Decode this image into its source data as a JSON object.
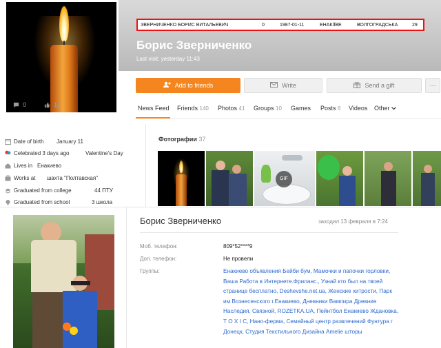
{
  "header": {
    "record": {
      "full_name": "ЗВЕРНИЧЕНКО БОРИС ВИТАЛЬЕВИЧ",
      "num": "0",
      "date": "1987-01-11",
      "city": "ЕНАКІЇВЕ",
      "street": "ВОЛГОГРАДСЬКА",
      "house": "29"
    },
    "name": "Борис Зверниченко",
    "last_visit": "Last visit: yesterday 11:43"
  },
  "avatar": {
    "comments": "0",
    "likes": "11"
  },
  "actions": {
    "add_friends": "Add to friends",
    "write": "Write",
    "send_gift": "Send a gift",
    "more": "···"
  },
  "nav": [
    {
      "label": "News Feed",
      "count": ""
    },
    {
      "label": "Friends",
      "count": "140"
    },
    {
      "label": "Photos",
      "count": "41"
    },
    {
      "label": "Groups",
      "count": "10"
    },
    {
      "label": "Games",
      "count": ""
    },
    {
      "label": "Posts",
      "count": "6"
    },
    {
      "label": "Videos",
      "count": ""
    },
    {
      "label": "Other",
      "count": ""
    }
  ],
  "info": [
    {
      "icon": "calendar-icon",
      "label": "Date of birth",
      "value": "January 11"
    },
    {
      "icon": "balloon-icon",
      "label": "Celebrated 3 days ago",
      "value": "Valentine's Day"
    },
    {
      "icon": "home-icon",
      "label": "Lives in",
      "value": "Енакиево"
    },
    {
      "icon": "briefcase-icon",
      "label": "Works at",
      "value": "шахта \"Полтавская\""
    },
    {
      "icon": "graduation-icon",
      "label": "Graduated from college",
      "value": "44 ПТУ"
    },
    {
      "icon": "school-icon",
      "label": "Graduated from school",
      "value": "3 школа"
    }
  ],
  "photos": {
    "title": "Фотографии",
    "count": "37",
    "gif_label": "GIF"
  },
  "card": {
    "name": "Борис Зверниченко",
    "last_visit": "заходил 13 февраля в 7:24",
    "mobile_label": "Моб. телефон:",
    "mobile_value": "809*52****9",
    "extra_label": "Доп. телефон:",
    "extra_value": "Не провели",
    "groups_label": "Группы:",
    "groups_text": "Енакиево объявления Бейби бум, Мамочки и папочки горловки, Ваша Работа в Интернете.Фриланс., Узнай кто был на твоей странице бесплатно, Deshevshe.net.ua, Женские хитрости, Парк им Вознесенского г.Енакиево, Дневники Вампира Древние Наследия, Связной, ROZETKA.UA, Пейнтбол Енакиево Ждановка, Т О Х I С, Нано-ферма, Семейный центр развлечений Фунтура г Донецк, Студия Текстильного Дизайна Amelie шторы"
  },
  "colors": {
    "accent": "#f5861f",
    "link": "#2d6ad0",
    "record_border": "#e11111"
  }
}
